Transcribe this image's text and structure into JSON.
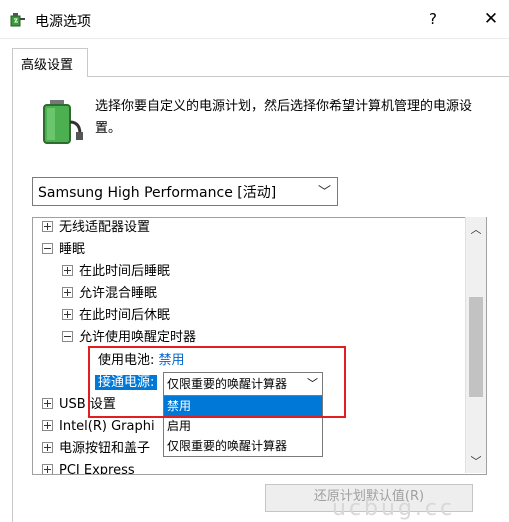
{
  "window": {
    "title": "电源选项",
    "help_label": "?",
    "close_label": "✕"
  },
  "tab": {
    "label": "高级设置"
  },
  "description": "选择你要自定义的电源计划，然后选择你希望计算机管理的电源设置。",
  "plan_select": {
    "value": "Samsung High Performance [活动]"
  },
  "tree": {
    "wireless": "无线适配器设置",
    "sleep": "睡眠",
    "sleep_after": "在此时间后睡眠",
    "hybrid_sleep": "允许混合睡眠",
    "hibernate_after": "在此时间后休眠",
    "wake_timers": "允许使用唤醒定时器",
    "on_battery_label": "使用电池:",
    "on_battery_value": "禁用",
    "plugged_in_label": "接通电源:",
    "plugged_in_value": "仅限重要的唤醒计算器",
    "usb": "USB 设置",
    "intel": "Intel(R) Graphi",
    "power_buttons": "电源按钮和盖子",
    "pci": "PCI Express"
  },
  "dropdown_options": [
    "禁用",
    "启用",
    "仅限重要的唤醒计算器"
  ],
  "restore_button": "还原计划默认值(R)",
  "watermark": "ucbug.cc",
  "icons": [
    "power-options-icon",
    "battery-icon",
    "chevron-down-icon",
    "scroll-up-icon",
    "scroll-down-icon"
  ],
  "colors": {
    "selection": "#0078d7",
    "link": "#0066cc",
    "annotation_box": "#e02020"
  }
}
